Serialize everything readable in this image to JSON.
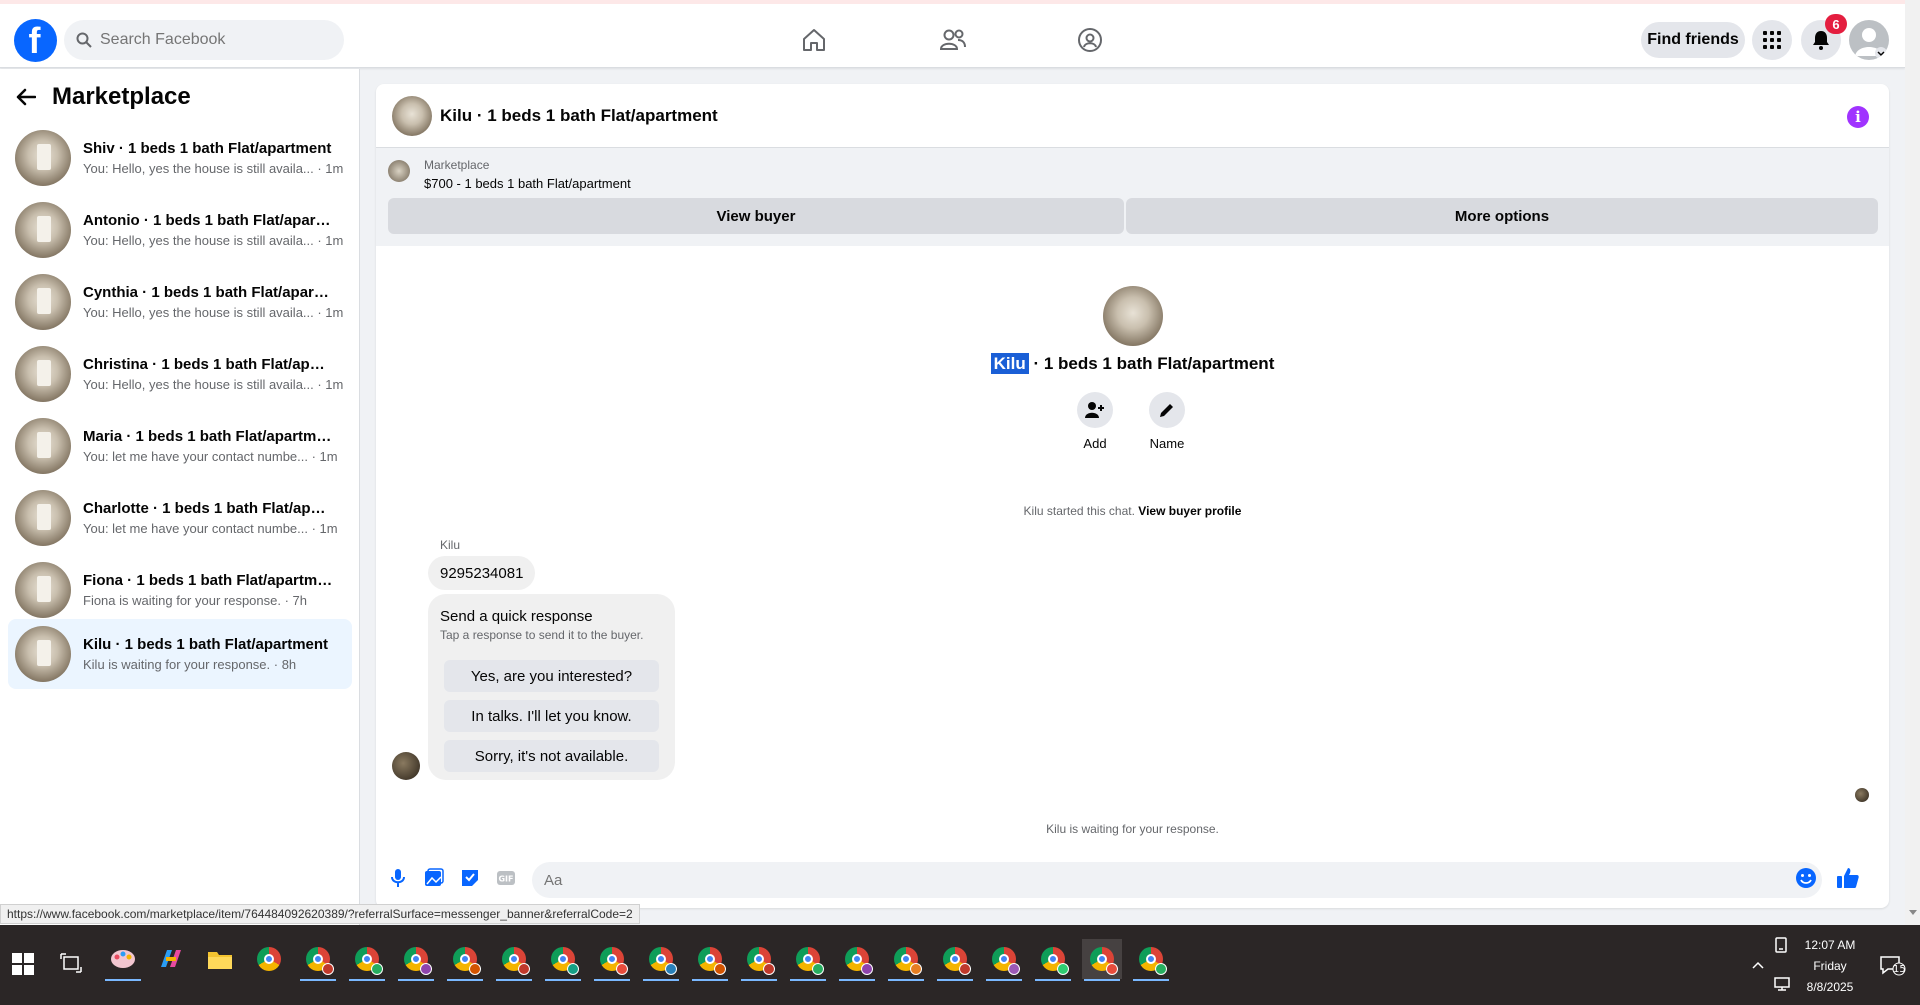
{
  "topbar": {
    "logo_letter": "f",
    "search_placeholder": "Search Facebook",
    "find_friends_label": "Find friends",
    "notification_count": "6"
  },
  "sidebar": {
    "title": "Marketplace",
    "items": [
      {
        "name": "Shiv · 1 beds 1 bath Flat/apartment",
        "preview": "You: Hello, yes the house is still availa... · 1m"
      },
      {
        "name": "Antonio · 1 beds 1 bath Flat/apart...",
        "preview": "You: Hello, yes the house is still availa... · 1m"
      },
      {
        "name": "Cynthia · 1 beds 1 bath Flat/apartm...",
        "preview": "You: Hello, yes the house is still availa... · 1m"
      },
      {
        "name": "Christina · 1 beds 1 bath Flat/apart...",
        "preview": "You: Hello, yes the house is still availa... · 1m"
      },
      {
        "name": "Maria · 1 beds 1 bath Flat/apartment",
        "preview": "You: let me have your contact numbe... · 1m"
      },
      {
        "name": "Charlotte · 1 beds 1 bath Flat/apart...",
        "preview": "You: let me have your contact numbe... · 1m"
      },
      {
        "name": "Fiona · 1 beds 1 bath Flat/apartment",
        "preview": "Fiona is waiting for your response. · 7h"
      },
      {
        "name": "Kilu · 1 beds 1 bath Flat/apartment",
        "preview": "Kilu is waiting for your response. · 8h"
      }
    ]
  },
  "chat": {
    "header_title": "Kilu · 1 beds 1 bath Flat/apartment",
    "banner_label": "Marketplace",
    "banner_price": "$700 - 1 beds 1 bath Flat/apartment",
    "view_buyer_label": "View buyer",
    "more_options_label": "More options",
    "center_name_highlight": "Kilu",
    "center_title_rest": " · 1 beds 1 bath Flat/apartment",
    "add_label": "Add",
    "name_label": "Name",
    "started_text": "Kilu started this chat.",
    "view_profile_label": "View buyer profile",
    "sender_name": "Kilu",
    "phone_message": "9295234081",
    "quick_title": "Send a quick response",
    "quick_subtitle": "Tap a response to send it to the buyer.",
    "quick_responses": [
      "Yes, are you interested?",
      "In talks. I'll let you know.",
      "Sorry, it's not available."
    ],
    "waiting_text": "Kilu is waiting for your response.",
    "composer_placeholder": "Aa"
  },
  "status_url": "https://www.facebook.com/marketplace/item/764484092620389/?referralSurface=messenger_banner&referralCode=2",
  "taskbar": {
    "time": "12:07 AM",
    "day": "Friday",
    "date": "8/8/2025",
    "notification_count": "15"
  },
  "colors": {
    "brand": "#0866ff",
    "accent_info": "#a033ff",
    "badge": "#e41e3f",
    "highlight": "#1a5fd6"
  }
}
